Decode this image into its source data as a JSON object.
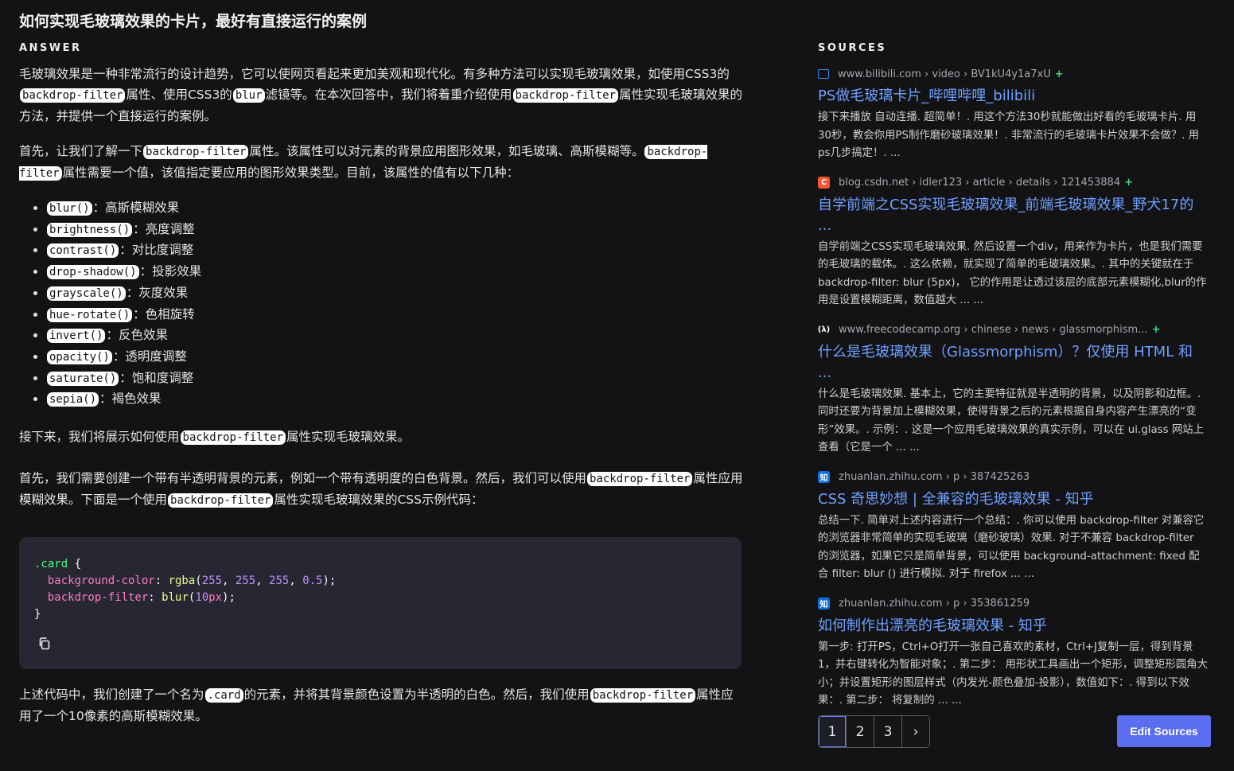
{
  "question": "如何实现毛玻璃效果的卡片，最好有直接运行的案例",
  "answer_label": "ANSWER",
  "sources_label": "SOURCES",
  "answer": {
    "p1": {
      "t1": "毛玻璃效果是一种非常流行的设计趋势，它可以使网页看起来更加美观和现代化。有多种方法可以实现毛玻璃效果，如使用CSS3的",
      "c1": "backdrop-filter",
      "t2": "属性、使用CSS3的",
      "c2": "blur",
      "t3": "滤镜等。在本次回答中，我们将着重介绍使用",
      "c3": "backdrop-filter",
      "t4": "属性实现毛玻璃效果的方法，并提供一个直接运行的案例。"
    },
    "p2": {
      "t1": "首先，让我们了解一下",
      "c1": "backdrop-filter",
      "t2": "属性。该属性可以对元素的背景应用图形效果，如毛玻璃、高斯模糊等。",
      "c2": "backdrop-filter",
      "t3": "属性需要一个值，该值指定要应用的图形效果类型。目前，该属性的值有以下几种："
    },
    "list": [
      {
        "code": "blur()",
        "desc": "：高斯模糊效果"
      },
      {
        "code": "brightness()",
        "desc": "：亮度调整"
      },
      {
        "code": "contrast()",
        "desc": "：对比度调整"
      },
      {
        "code": "drop-shadow()",
        "desc": "：投影效果"
      },
      {
        "code": "grayscale()",
        "desc": "：灰度效果"
      },
      {
        "code": "hue-rotate()",
        "desc": "：色相旋转"
      },
      {
        "code": "invert()",
        "desc": "：反色效果"
      },
      {
        "code": "opacity()",
        "desc": "：透明度调整"
      },
      {
        "code": "saturate()",
        "desc": "：饱和度调整"
      },
      {
        "code": "sepia()",
        "desc": "：褐色效果"
      }
    ],
    "p3": {
      "t1": "接下来，我们将展示如何使用",
      "c1": "backdrop-filter",
      "t2": "属性实现毛玻璃效果。"
    },
    "p4": {
      "t1": "首先，我们需要创建一个带有半透明背景的元素，例如一个带有透明度的白色背景。然后，我们可以使用",
      "c1": "backdrop-filter",
      "t2": "属性应用模糊效果。下面是一个使用",
      "c2": "backdrop-filter",
      "t3": "属性实现毛玻璃效果的CSS示例代码："
    },
    "code": {
      "selector": ".card",
      "open": " {",
      "prop1": "background-color",
      "fn1": "rgba",
      "args": [
        "255",
        "255",
        "255",
        "0.5"
      ],
      "prop2": "backdrop-filter",
      "fn2": "blur",
      "num2": "10",
      "unit2": "px",
      "close": "}"
    },
    "p5": {
      "t1": "上述代码中，我们创建了一个名为",
      "c1": ".card",
      "t2": "的元素，并将其背景颜色设置为半透明的白色。然后，我们使用",
      "c2": "backdrop-filter",
      "t3": "属性应用了一个10像素的高斯模糊效果。"
    }
  },
  "sources": [
    {
      "icon": "bilibili-icon",
      "meta": "www.bilibili.com › video › BV1kU4y1a7xU",
      "title": "PS做毛玻璃卡片_哔哩哔哩_bilibili",
      "snippet": "接下来播放 自动连播. 超简单！. 用这个方法30秒就能做出好看的毛玻璃卡片. 用30秒，教会你用PS制作磨砂玻璃效果！. 非常流行的毛玻璃卡片效果不会做？. 用ps几步搞定！. ..."
    },
    {
      "icon": "csdn-icon",
      "icon_text": "C",
      "meta": "blog.csdn.net › idler123 › article › details › 121453884",
      "title": "自学前端之CSS实现毛玻璃效果_前端毛玻璃效果_野犬17的 ...",
      "snippet": "自学前端之CSS实现毛玻璃效果. 然后设置一个div，用来作为卡片，也是我们需要的毛玻璃的载体。. 这么依赖，就实现了简单的毛玻璃效果。. 其中的关键就在于 backdrop-filter: blur (5px)， 它的作用是让透过该层的底部元素模糊化,blur的作用是设置模糊距离，数值越大 ... ..."
    },
    {
      "icon": "freecodecamp-icon",
      "icon_text": "(λ)",
      "meta": "www.freecodecamp.org › chinese › news › glassmorphism...",
      "title": "什么是毛玻璃效果（Glassmorphism）？仅使用 HTML 和 ...",
      "snippet": "什么是毛玻璃效果. 基本上，它的主要特征就是半透明的背景，以及阴影和边框。. 同时还要为背景加上模糊效果，使得背景之后的元素根据自身内容产生漂亮的“变形”效果。. 示例：. 这是一个应用毛玻璃效果的真实示例，可以在 ui.glass 网站上查看（它是一个 ... ..."
    },
    {
      "icon": "zhihu-icon",
      "icon_text": "知",
      "meta": "zhuanlan.zhihu.com › p › 387425263",
      "title": "CSS 奇思妙想 | 全兼容的毛玻璃效果 - 知乎",
      "snippet": "总结一下. 简单对上述内容进行一个总结：. 你可以使用 backdrop-filter 对兼容它的浏览器非常简单的实现毛玻璃（磨砂玻璃）效果. 对于不兼容 backdrop-filter 的浏览器，如果它只是简单背景，可以使用 background-attachment: fixed 配合 filter: blur () 进行模拟. 对于 firefox ... ..."
    },
    {
      "icon": "zhihu-icon",
      "icon_text": "知",
      "meta": "zhuanlan.zhihu.com › p › 353861259",
      "title": "如何制作出漂亮的毛玻璃效果 - 知乎",
      "snippet": "第一步: 打开PS，Ctrl+O打开一张自己喜欢的素材，Ctrl+J复制一层，得到背景1，并右键转化为智能对象；. 第二步： 用形状工具画出一个矩形，调整矩形圆角大小；并设置矩形的图层样式（内发光-颜色叠加-投影），数值如下：. 得到以下效果：. 第二步： 将复制的 ... ..."
    }
  ],
  "pagination": {
    "pages": [
      "1",
      "2",
      "3"
    ],
    "current": "1",
    "next": "›"
  },
  "edit_sources_label": "Edit Sources"
}
